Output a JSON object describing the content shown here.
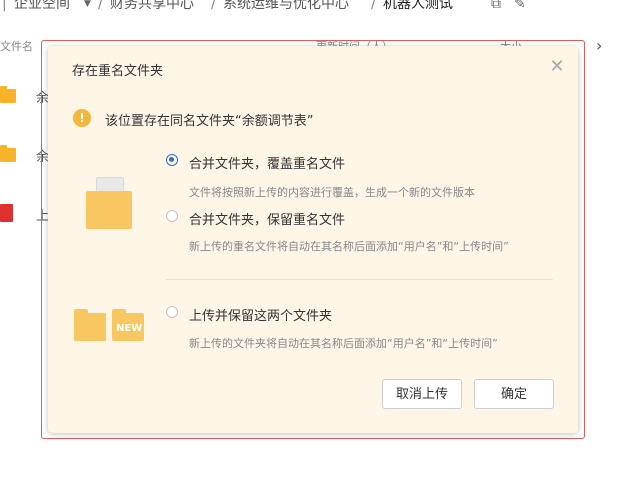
{
  "breadcrumb": {
    "items": [
      "企业空间",
      "财务共享中心",
      "系统运维与优化中心",
      "机器人测试"
    ],
    "separator": "/"
  },
  "file_list": {
    "header": {
      "name_label": "文件名",
      "time_label": "更新时间（人）",
      "size_label": "大小"
    },
    "rows": [
      {
        "text": "余",
        "kind": "folder"
      },
      {
        "text": "余",
        "kind": "folder"
      },
      {
        "text": "上",
        "kind": "pdf"
      }
    ]
  },
  "dialog": {
    "title": "存在重名文件夹",
    "close_icon": "close-icon",
    "warning": "该位置存在同名文件夹“余额调节表”",
    "options": [
      {
        "label": "合并文件夹，覆盖重名文件",
        "description": "文件将按照新上传的内容进行覆盖，生成一个新的文件版本",
        "checked": true
      },
      {
        "label": "合并文件夹，保留重名文件",
        "description": "新上传的重名文件将自动在其名称后面添加“用户名”和“上传时间”",
        "checked": false
      },
      {
        "label": "上传并保留这两个文件夹",
        "description": "新上传的文件夹将自动在其名称后面添加“用户名”和“上传时间”",
        "checked": false
      }
    ],
    "new_badge": "NEW",
    "cancel_label": "取消上传",
    "confirm_label": "确定"
  },
  "colors": {
    "dialog_bg": "#fdf5e6",
    "accent": "#2f6bd8",
    "warning": "#f4b63b",
    "folder": "#f9c761",
    "highlight_outline": "#e05a5a"
  }
}
